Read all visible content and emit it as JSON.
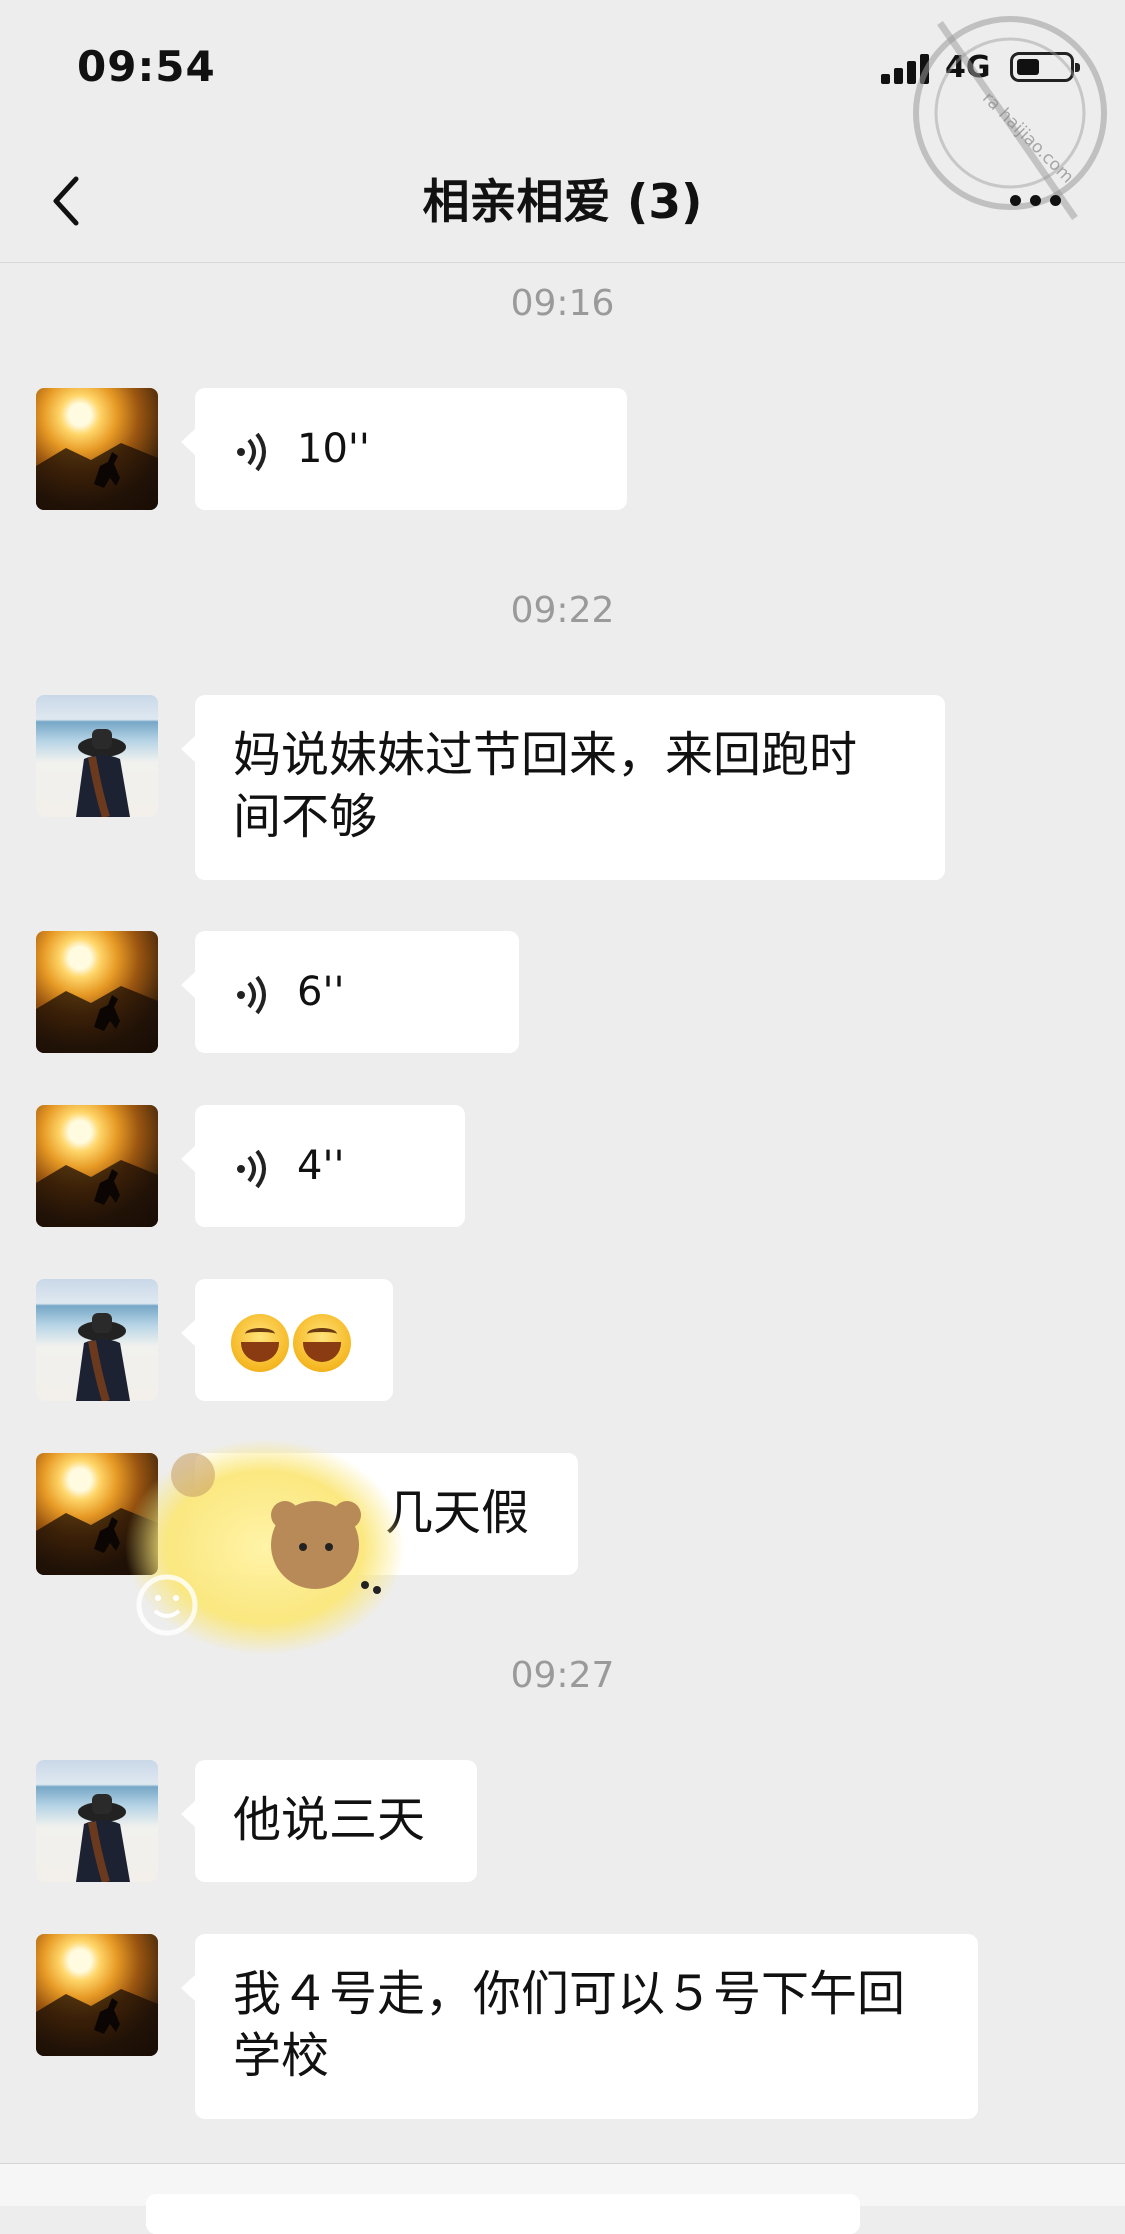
{
  "status": {
    "time": "09:54",
    "network": "4G",
    "battery_level": 0.4
  },
  "header": {
    "title": "相亲相爱 (3)",
    "back_icon": "chevron-left-icon",
    "more_icon": "ellipsis-icon"
  },
  "watermark": {
    "text": "ra haijiao.com"
  },
  "messages": [
    {
      "timestamp": "09:16"
    },
    {
      "kind": "voice",
      "avatar": "sunset-avatar",
      "duration": "10''"
    },
    {
      "timestamp": "09:22"
    },
    {
      "kind": "text",
      "avatar": "beach-avatar",
      "lines": [
        "妈说妹妹过节回来，来回跑时",
        "间不够"
      ]
    },
    {
      "kind": "voice",
      "avatar": "sunset-avatar",
      "duration": "6''"
    },
    {
      "kind": "voice",
      "avatar": "sunset-avatar",
      "duration": "4''"
    },
    {
      "kind": "emoji",
      "avatar": "beach-avatar",
      "emoji": [
        "grin-emoji",
        "grin-emoji"
      ]
    },
    {
      "kind": "text",
      "avatar": "sunset-avatar",
      "lines": [
        "几天假"
      ],
      "covered_by_sticker": true
    },
    {
      "timestamp": "09:27"
    },
    {
      "kind": "text",
      "avatar": "beach-avatar",
      "lines": [
        "他说三天"
      ]
    },
    {
      "kind": "text",
      "avatar": "sunset-avatar",
      "lines": [
        "我４号走，你们可以５号下午回",
        "学校"
      ]
    }
  ]
}
